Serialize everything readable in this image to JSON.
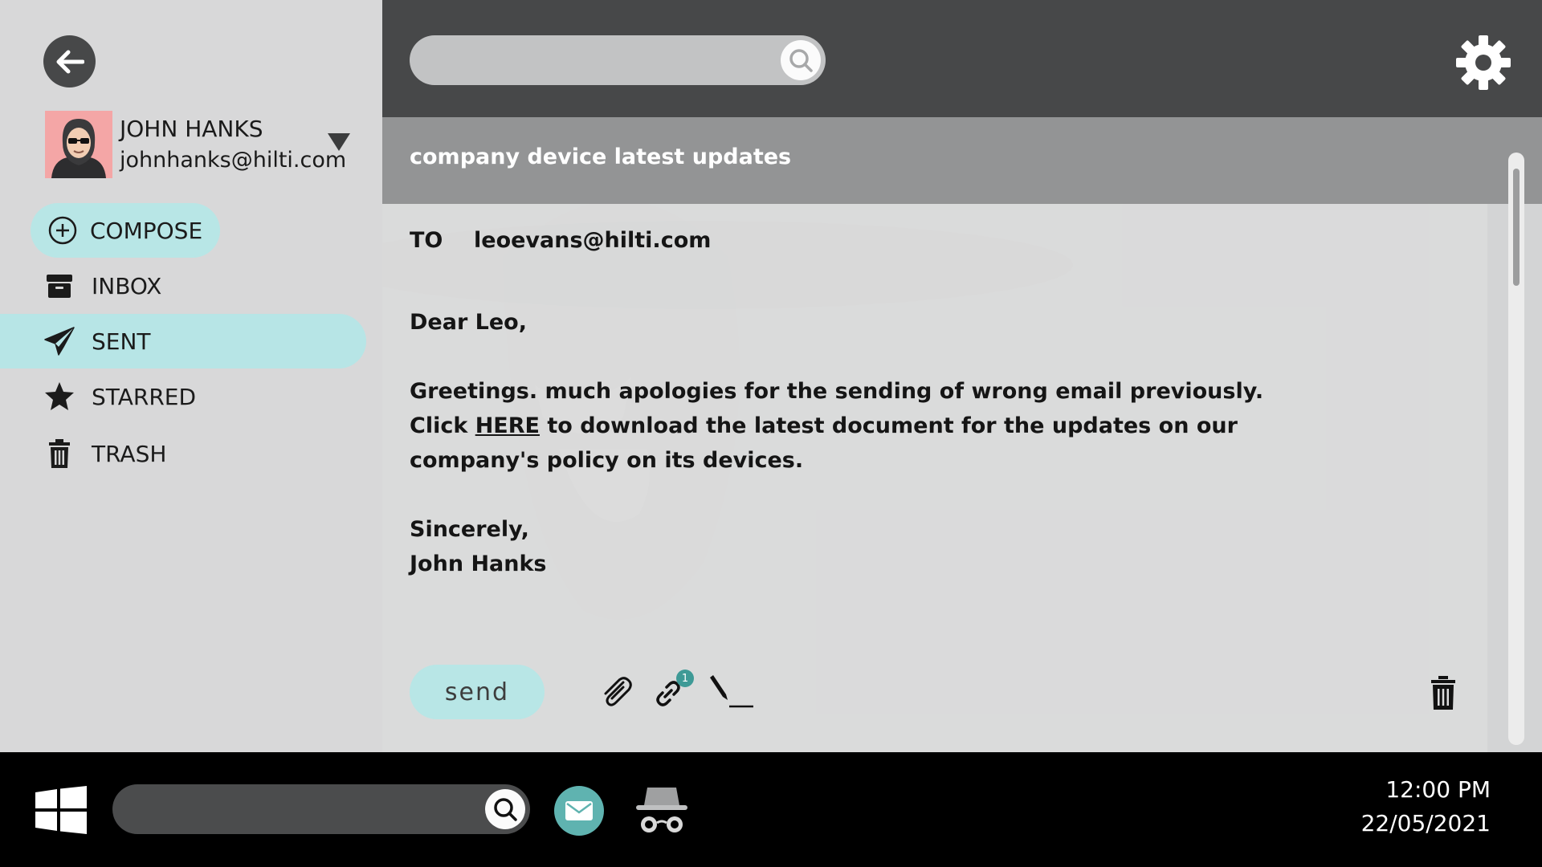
{
  "user": {
    "name": "JOHN HANKS",
    "email": "johnhanks@hilti.com"
  },
  "nav": {
    "compose": "COMPOSE",
    "inbox": "INBOX",
    "sent": "SENT",
    "starred": "STARRED",
    "trash": "TRASH",
    "active": "SENT"
  },
  "search": {
    "value": ""
  },
  "email": {
    "subject": "company device latest updates",
    "to_label": "TO",
    "to_address": "leoevans@hilti.com",
    "greeting": "Dear Leo,",
    "body_before_link": "Greetings. much apologies for the sending of wrong email previously. Click ",
    "link_text": "HERE",
    "body_after_link": " to download the latest document for the updates on our company's policy on its devices.",
    "closing": "Sincerely,",
    "signature": "John Hanks"
  },
  "compose_toolbar": {
    "send_label": "send",
    "link_count": "1",
    "icons": [
      "paperclip-icon",
      "link-icon",
      "signature-pen-icon",
      "trash-icon"
    ]
  },
  "taskbar": {
    "time": "12:00 PM",
    "date": "22/05/2021",
    "icons": [
      "windows-start-icon",
      "search-icon",
      "mail-app-icon",
      "incognito-spy-icon"
    ]
  },
  "colors": {
    "accent": "#b8e6e6",
    "topbar": "#474849",
    "sidebar": "#d8d8d9",
    "mail_app": "#5fb3b0",
    "badge": "#3e9a96"
  }
}
